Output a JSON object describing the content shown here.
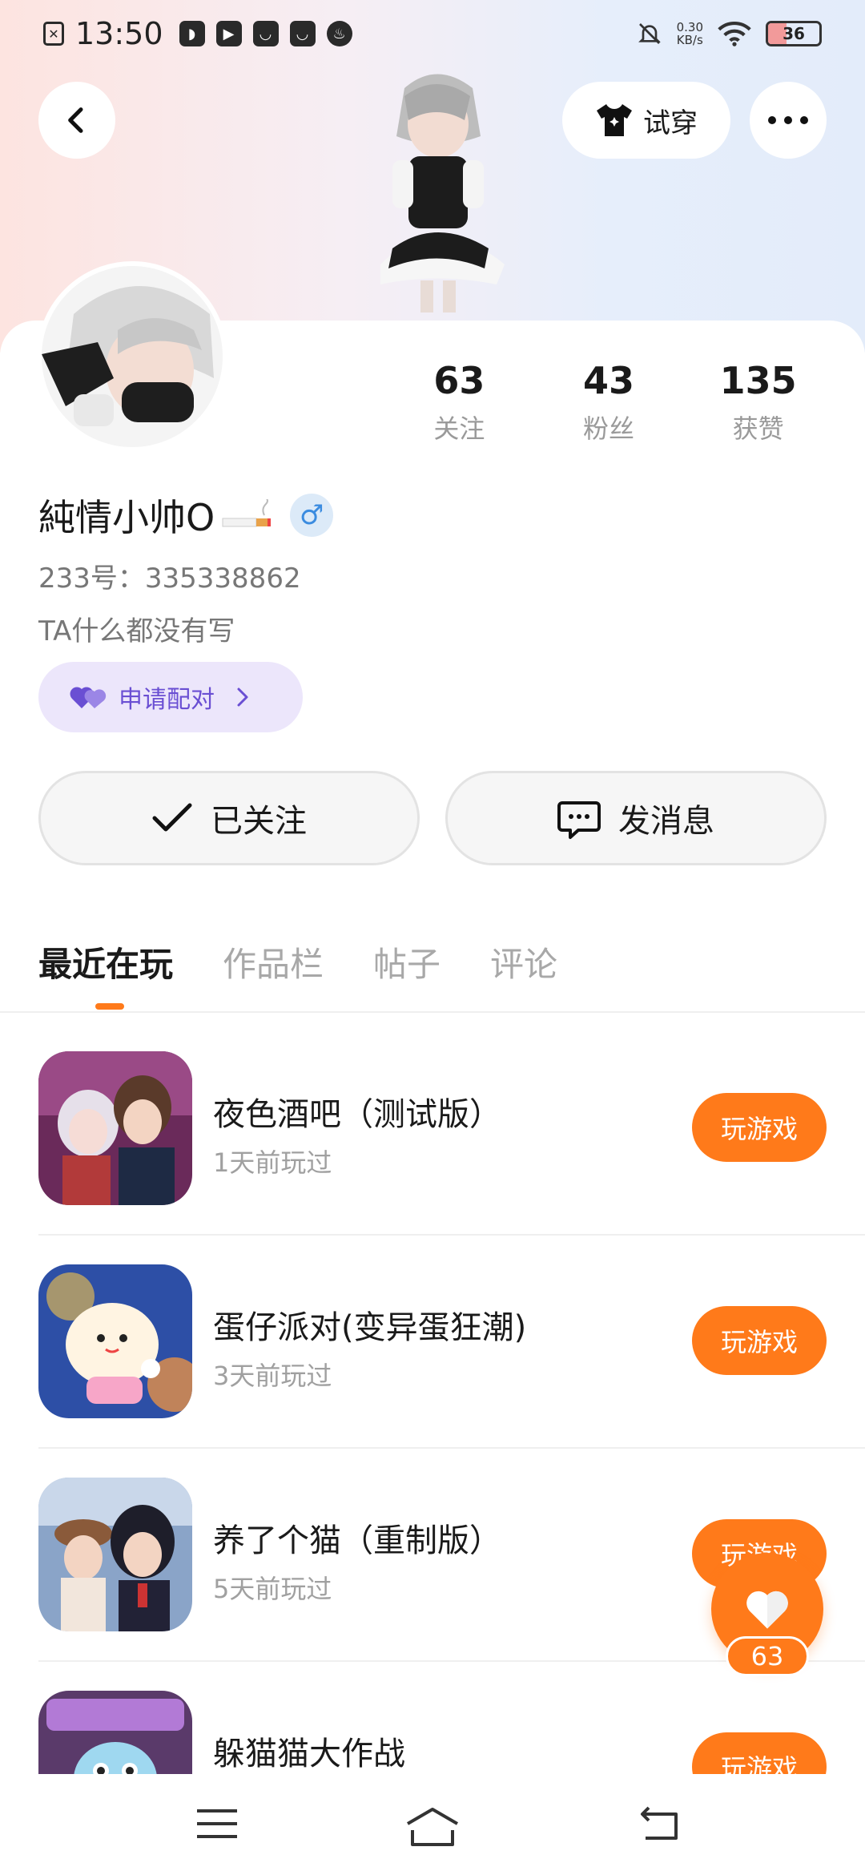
{
  "status_bar": {
    "time": "13:50",
    "net_speed_value": "0.30",
    "net_speed_unit": "KB/s",
    "battery_level": "36"
  },
  "header": {
    "tryon_label": "试穿"
  },
  "stats": [
    {
      "value": "63",
      "label": "关注"
    },
    {
      "value": "43",
      "label": "粉丝"
    },
    {
      "value": "135",
      "label": "获赞"
    }
  ],
  "profile": {
    "nickname": "純情小帅O",
    "gender_symbol": "♂",
    "user_id": "233号：335338862",
    "bio": "TA什么都没有写",
    "pair_label": "申请配对"
  },
  "actions": {
    "follow_label": "已关注",
    "message_label": "发消息"
  },
  "tabs": [
    "最近在玩",
    "作品栏",
    "帖子",
    "评论"
  ],
  "games": [
    {
      "name": "夜色酒吧（测试版）",
      "last_played": "1天前玩过",
      "button": "玩游戏"
    },
    {
      "name": "蛋仔派对(变异蛋狂潮)",
      "last_played": "3天前玩过",
      "button": "玩游戏"
    },
    {
      "name": "养了个猫（重制版）",
      "last_played": "5天前玩过",
      "button": "玩游戏"
    },
    {
      "name": "躲猫猫大作战",
      "last_played": "",
      "button": "玩游戏"
    }
  ],
  "float_like": {
    "count": "63"
  },
  "icons": {
    "back": "chevron-left-icon",
    "more": "more-dots-icon",
    "tryon": "shirt-icon",
    "check": "check-icon",
    "message": "chat-bubble-icon",
    "heart": "heart-icon",
    "pair": "hearts-icon",
    "chevron": "chevron-right-icon"
  },
  "colors": {
    "accent": "#ff7a1a",
    "pair_bg": "#ece6fb",
    "pair_text": "#6a4fd3"
  }
}
